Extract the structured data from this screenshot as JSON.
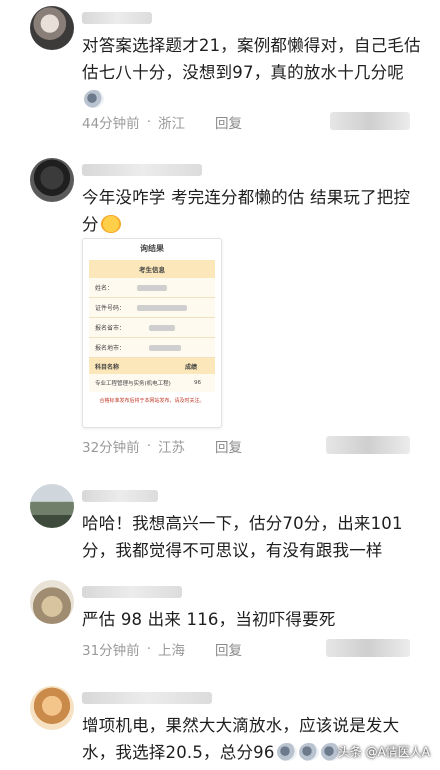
{
  "comments": [
    {
      "text": "对答案选择题才21，案例都懒得对，自己毛估估七八十分，没想到97，真的放水十几分呢",
      "emoji": "cat-emoji",
      "time": "44分钟前",
      "location": "浙江",
      "reply": "回复"
    },
    {
      "text": "今年没咋学 考完连分都懒的估 结果玩了把控分",
      "emoji": "hot-face-emoji",
      "time": "32分钟前",
      "location": "江苏",
      "reply": "回复"
    },
    {
      "text": "哈哈！我想高兴一下，估分70分，出来101分，我都觉得不可思议，有没有跟我一样"
    },
    {
      "text": "严估 98 出来 116，当初吓得要死",
      "time": "31分钟前",
      "location": "上海",
      "reply": "回复"
    },
    {
      "text": "增项机电，果然大大滴放水，应该说是发大水，我选择20.5，总分96"
    }
  ],
  "score_card": {
    "title": "询结果",
    "section_header": "考生信息",
    "rows": [
      "姓名：",
      "证件号码：",
      "报名省市：",
      "报名地市："
    ],
    "subject_header": "科目名称",
    "score_header": "成绩",
    "subject": "专业工程管理与实务(机电工程)",
    "score": "96",
    "note": "合格标准发布后将于本网站发布，请及时关注。"
  },
  "watermark": "头条 @A情医人A"
}
